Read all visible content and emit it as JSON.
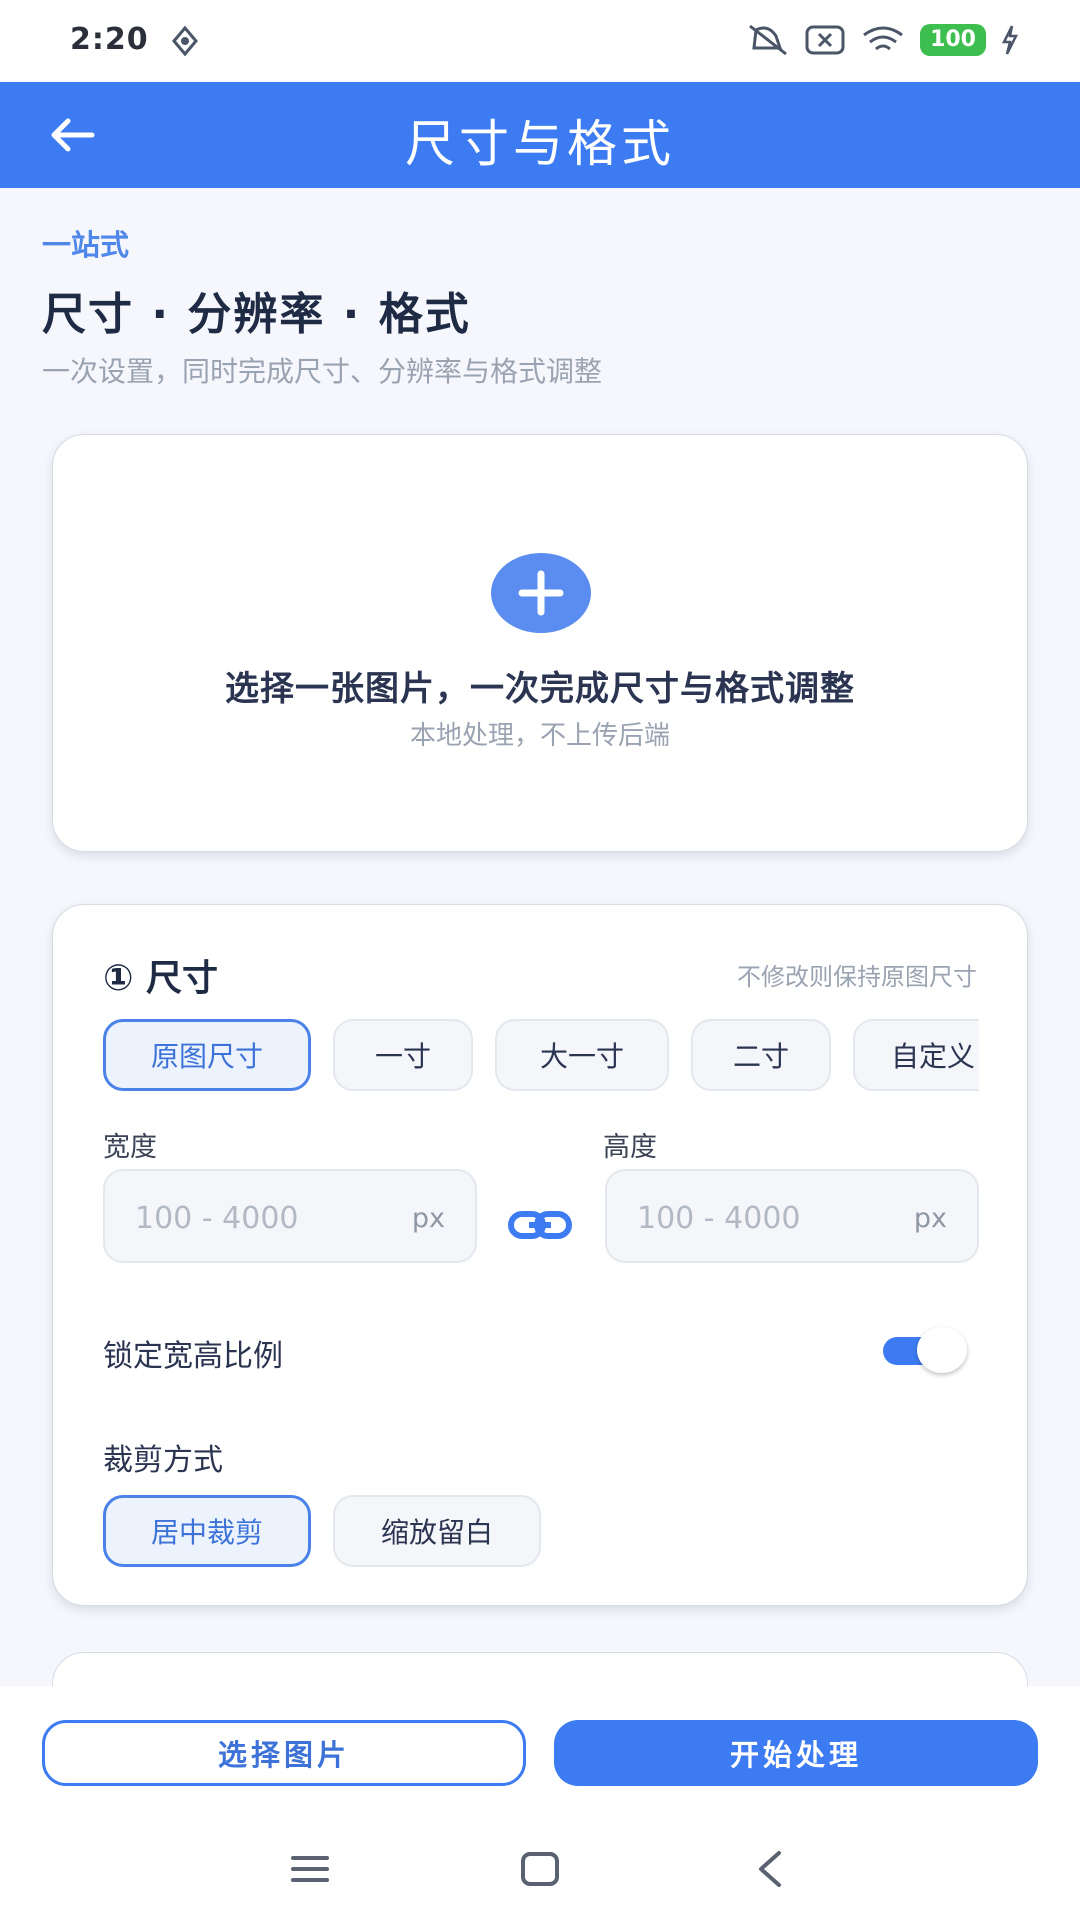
{
  "status_bar": {
    "time": "2:20",
    "battery": "100"
  },
  "app_bar": {
    "title": "尺寸与格式"
  },
  "header": {
    "eyebrow": "一站式",
    "headline": "尺寸 · 分辨率 · 格式",
    "subhead": "一次设置，同时完成尺寸、分辨率与格式调整"
  },
  "upload": {
    "title": "选择一张图片，一次完成尺寸与格式调整",
    "subtitle": "本地处理，不上传后端"
  },
  "size_section": {
    "title": "① 尺寸",
    "hint": "不修改则保持原图尺寸",
    "presets": [
      {
        "label": "原图尺寸",
        "selected": true
      },
      {
        "label": "一寸",
        "selected": false
      },
      {
        "label": "大一寸",
        "selected": false
      },
      {
        "label": "二寸",
        "selected": false
      },
      {
        "label": "自定义",
        "selected": false
      }
    ],
    "width": {
      "label": "宽度",
      "placeholder": "100 - 4000",
      "unit": "px"
    },
    "height": {
      "label": "高度",
      "placeholder": "100 - 4000",
      "unit": "px"
    },
    "lock_ratio": {
      "label": "锁定宽高比例",
      "on": true
    },
    "crop": {
      "label": "裁剪方式",
      "options": [
        {
          "label": "居中裁剪",
          "selected": true
        },
        {
          "label": "缩放留白",
          "selected": false
        }
      ]
    }
  },
  "actions": {
    "select_image": "选择图片",
    "start": "开始处理"
  },
  "colors": {
    "primary": "#3d7bf2",
    "background": "#f5f7fc",
    "battery": "#3cbf4e"
  }
}
